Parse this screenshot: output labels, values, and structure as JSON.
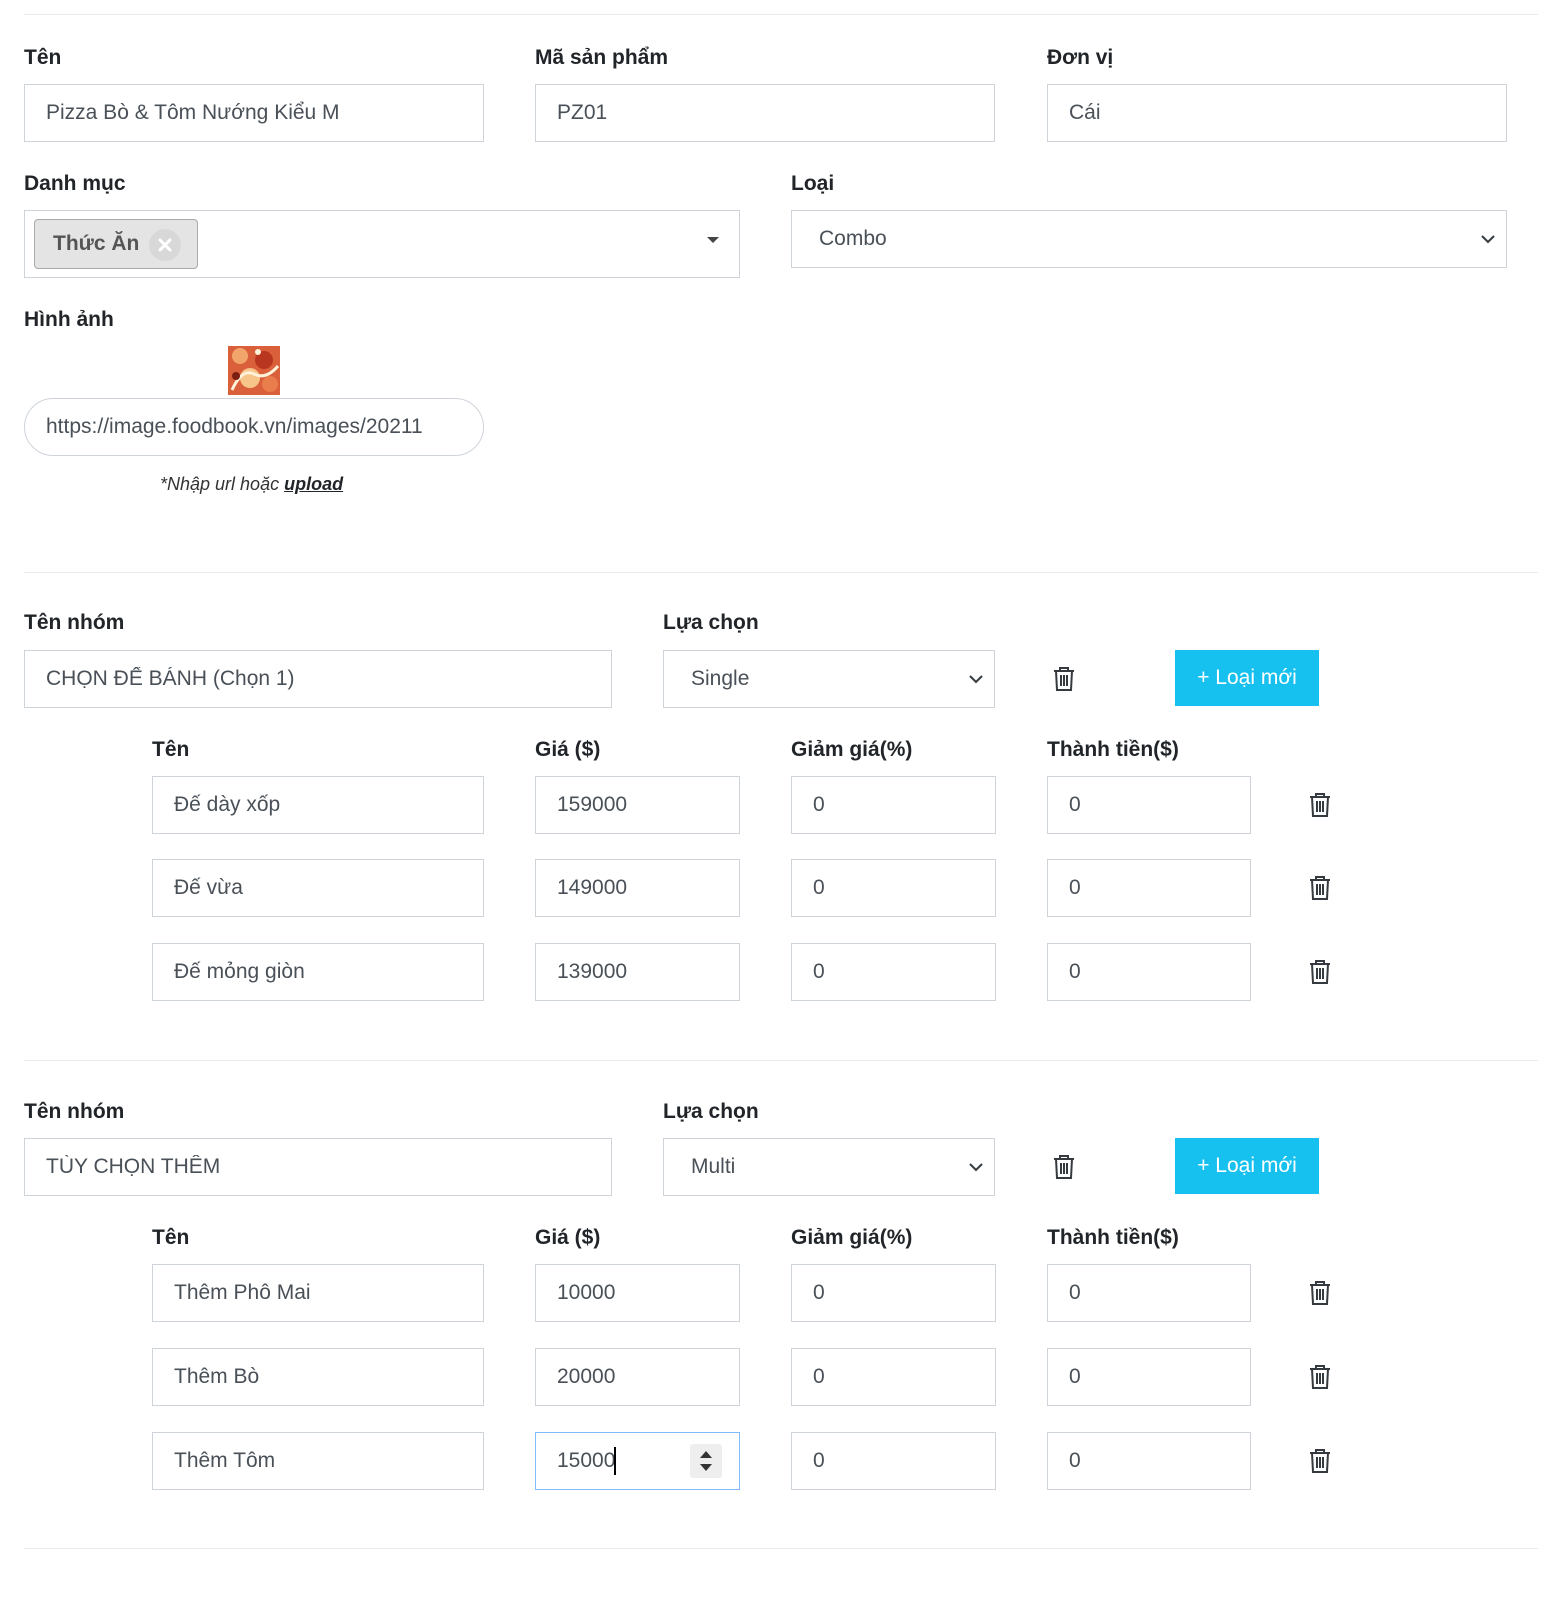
{
  "product": {
    "name_label": "Tên",
    "name_value": "Pizza Bò & Tôm Nướng Kiểu M",
    "code_label": "Mã sản phẩm",
    "code_value": "PZ01",
    "unit_label": "Đơn vị",
    "unit_value": "Cái",
    "category_label": "Danh mục",
    "category_tag": "Thức Ăn",
    "type_label": "Loại",
    "type_value": "Combo",
    "image_label": "Hình ảnh",
    "image_url": "https://image.foodbook.vn/images/20211",
    "image_hint": "*Nhập url hoặc",
    "image_hint_link": "upload"
  },
  "groups": [
    {
      "name_label": "Tên nhóm",
      "name_value": "CHỌN ĐẾ BÁNH (Chọn 1)",
      "choice_label": "Lựa chọn",
      "choice_value": "Single",
      "add_button": "+ Loại mới",
      "col_name": "Tên",
      "col_price": "Giá ($)",
      "col_discount": "Giảm giá(%)",
      "col_total": "Thành tiền($)",
      "items": [
        {
          "name": "Đế dày xốp",
          "price": "159000",
          "discount": "0",
          "total": "0"
        },
        {
          "name": "Đế vừa",
          "price": "149000",
          "discount": "0",
          "total": "0"
        },
        {
          "name": "Đế mỏng giòn",
          "price": "139000",
          "discount": "0",
          "total": "0"
        }
      ]
    },
    {
      "name_label": "Tên nhóm",
      "name_value": "TÙY CHỌN THÊM",
      "choice_label": "Lựa chọn",
      "choice_value": "Multi",
      "add_button": "+ Loại mới",
      "col_name": "Tên",
      "col_price": "Giá ($)",
      "col_discount": "Giảm giá(%)",
      "col_total": "Thành tiền($)",
      "items": [
        {
          "name": "Thêm Phô Mai",
          "price": "10000",
          "discount": "0",
          "total": "0"
        },
        {
          "name": "Thêm Bò",
          "price": "20000",
          "discount": "0",
          "total": "0"
        },
        {
          "name": "Thêm Tôm",
          "price": "15000",
          "discount": "0",
          "total": "0"
        }
      ]
    }
  ],
  "icons": {
    "trash": "trash-icon",
    "chevron": "chevron-down-icon",
    "remove_tag": "close-icon",
    "dropdown_caret": "caret-down-icon",
    "spinner": "number-spinner-icon"
  },
  "colors": {
    "accent": "#17c1ef",
    "border": "#ced4da",
    "focus_border": "#80bdff",
    "tag_bg": "#e4e4e4"
  }
}
